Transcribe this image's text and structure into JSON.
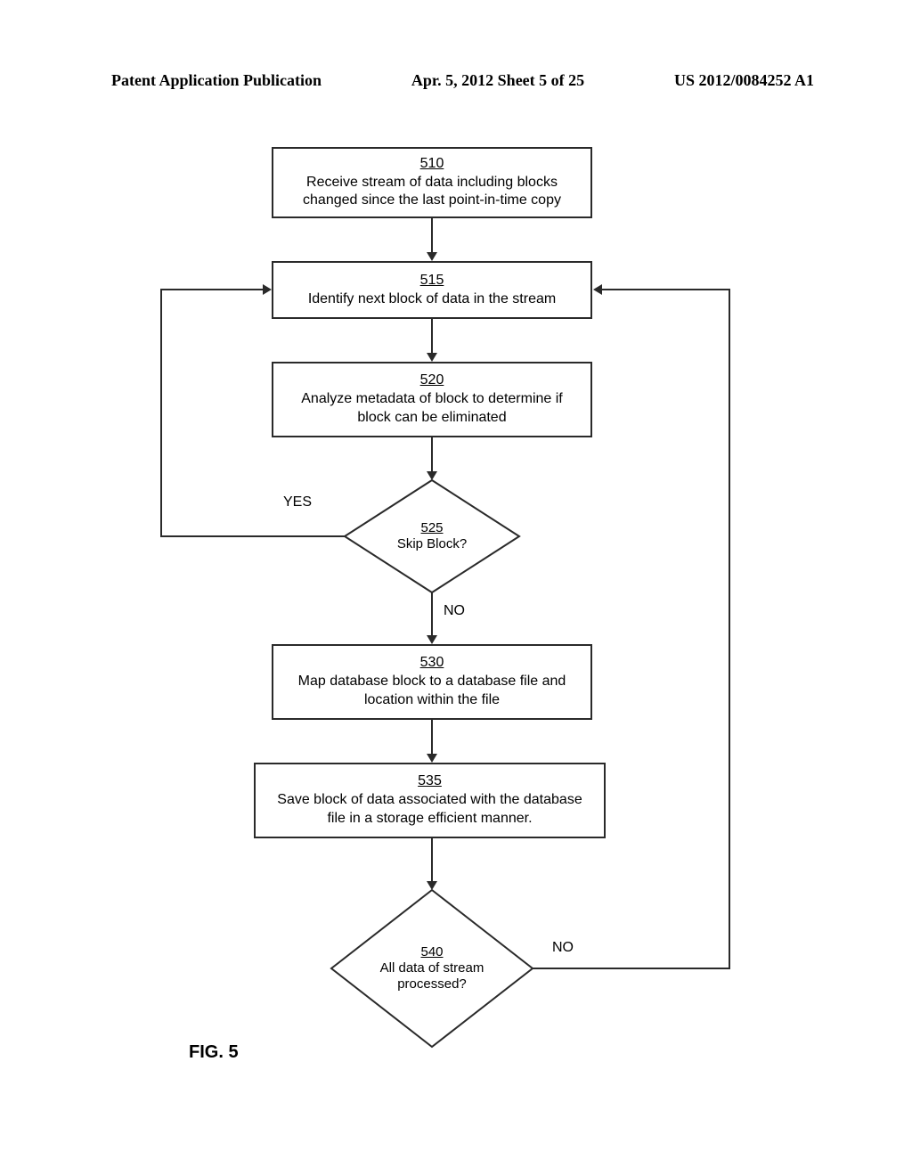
{
  "header": {
    "left": "Patent Application Publication",
    "center": "Apr. 5, 2012  Sheet 5 of 25",
    "right": "US 2012/0084252 A1"
  },
  "figure_label": "FIG. 5",
  "steps": {
    "s510": {
      "num": "510",
      "text": "Receive stream of data including blocks changed since the last point-in-time copy"
    },
    "s515": {
      "num": "515",
      "text": "Identify next block of data in the stream"
    },
    "s520": {
      "num": "520",
      "text": "Analyze metadata of block to determine if block can be eliminated"
    },
    "s525": {
      "num": "525",
      "text": "Skip Block?"
    },
    "s530": {
      "num": "530",
      "text": "Map database block to a database file and location within the file"
    },
    "s535": {
      "num": "535",
      "text": "Save block of data associated with the database file in a storage efficient manner."
    },
    "s540": {
      "num": "540",
      "text": "All data of stream processed?"
    }
  },
  "edges": {
    "yes": "YES",
    "no": "NO"
  }
}
